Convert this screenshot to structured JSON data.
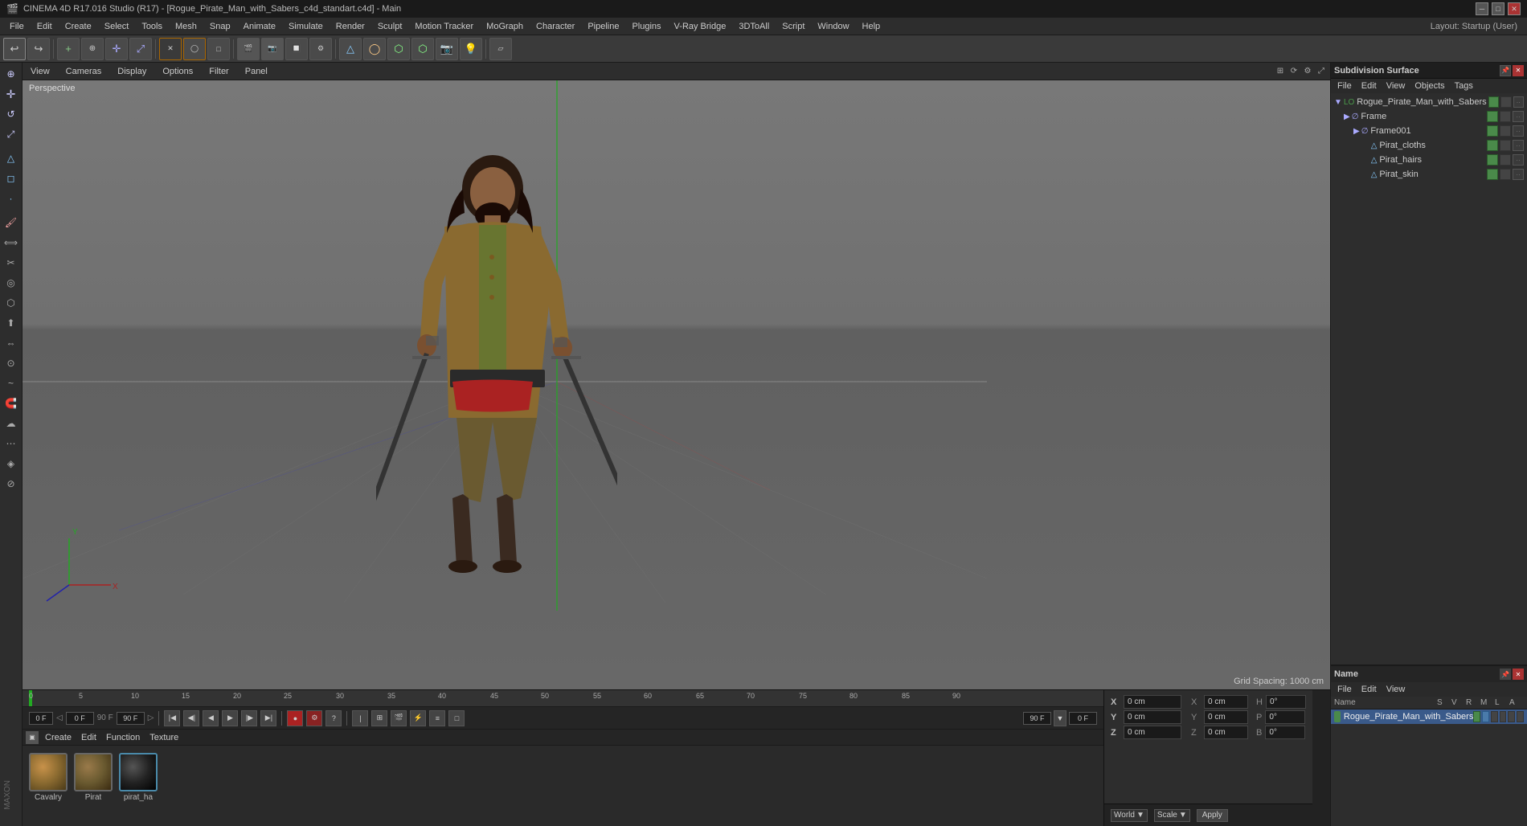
{
  "titlebar": {
    "title": "CINEMA 4D R17.016 Studio (R17) - [Rogue_Pirate_Man_with_Sabers_c4d_standart.c4d] - Main",
    "minimize": "─",
    "maximize": "□",
    "close": "✕"
  },
  "menubar": {
    "items": [
      "File",
      "Edit",
      "Create",
      "Select",
      "Tools",
      "Mesh",
      "Snap",
      "Animate",
      "Simulate",
      "Render",
      "Sculpt",
      "Motion Tracker",
      "MoGraph",
      "Character",
      "Pipeline",
      "Plugins",
      "V-Ray Bridge",
      "3DToAll",
      "Script",
      "Window",
      "Help"
    ],
    "layout_label": "Layout: Startup (User)"
  },
  "viewport": {
    "perspective_label": "Perspective",
    "grid_spacing": "Grid Spacing: 1000 cm",
    "menus": [
      "View",
      "Cameras",
      "Display",
      "Options",
      "Filter",
      "Panel"
    ]
  },
  "object_manager": {
    "title": "Subdivision Surface",
    "menus_top": [
      "File",
      "Edit",
      "View",
      "Objects",
      "Tags"
    ],
    "menus": [
      "File",
      "Edit",
      "View"
    ],
    "tree": [
      {
        "name": "Rogue_Pirate_Man_with_Sabers",
        "indent": 0,
        "icon": "lo",
        "expanded": true
      },
      {
        "name": "Frame",
        "indent": 1,
        "icon": "null"
      },
      {
        "name": "Frame001",
        "indent": 2,
        "icon": "null"
      },
      {
        "name": "Pirat_cloths",
        "indent": 3,
        "icon": "poly"
      },
      {
        "name": "Pirat_hairs",
        "indent": 3,
        "icon": "poly"
      },
      {
        "name": "Pirat_skin",
        "indent": 3,
        "icon": "poly"
      }
    ],
    "bottom_title": "Name",
    "bottom_cols": [
      "S",
      "V",
      "R",
      "M",
      "L",
      "A"
    ],
    "bottom_item": "Rogue_Pirate_Man_with_Sabers"
  },
  "timeline": {
    "start_frame": "0 F",
    "end_frame": "90 F",
    "current_frame": "0 F",
    "preview_start": "0 F",
    "preview_end": "90 F",
    "ticks": [
      "0",
      "5",
      "10",
      "15",
      "20",
      "25",
      "30",
      "35",
      "40",
      "45",
      "50",
      "55",
      "60",
      "65",
      "70",
      "75",
      "80",
      "85",
      "90"
    ]
  },
  "material_manager": {
    "menus": [
      "Create",
      "Edit",
      "Function",
      "Texture"
    ],
    "materials": [
      {
        "name": "Cavalry",
        "color": "#8a6a3a"
      },
      {
        "name": "Pirat",
        "color": "#6a5a3a"
      },
      {
        "name": "pirat_ha",
        "color": "#222222"
      }
    ]
  },
  "coordinates": {
    "x_pos": "0 cm",
    "y_pos": "0 cm",
    "z_pos": "0 cm",
    "x_size": "0 cm",
    "y_size": "0 cm",
    "z_size": "0 cm",
    "h_rot": "0°",
    "p_rot": "0°",
    "b_rot": "0°"
  },
  "bottom": {
    "world_label": "World",
    "scale_label": "Scale",
    "apply_label": "Apply"
  },
  "icons": {
    "arrow": "→",
    "triangle_right": "▶",
    "triangle_down": "▼",
    "move": "✛",
    "rotate": "↺",
    "scale": "⤢",
    "play": "▶",
    "stop": "■",
    "rewind": "◀◀",
    "forward": "▶▶",
    "record": "●"
  }
}
